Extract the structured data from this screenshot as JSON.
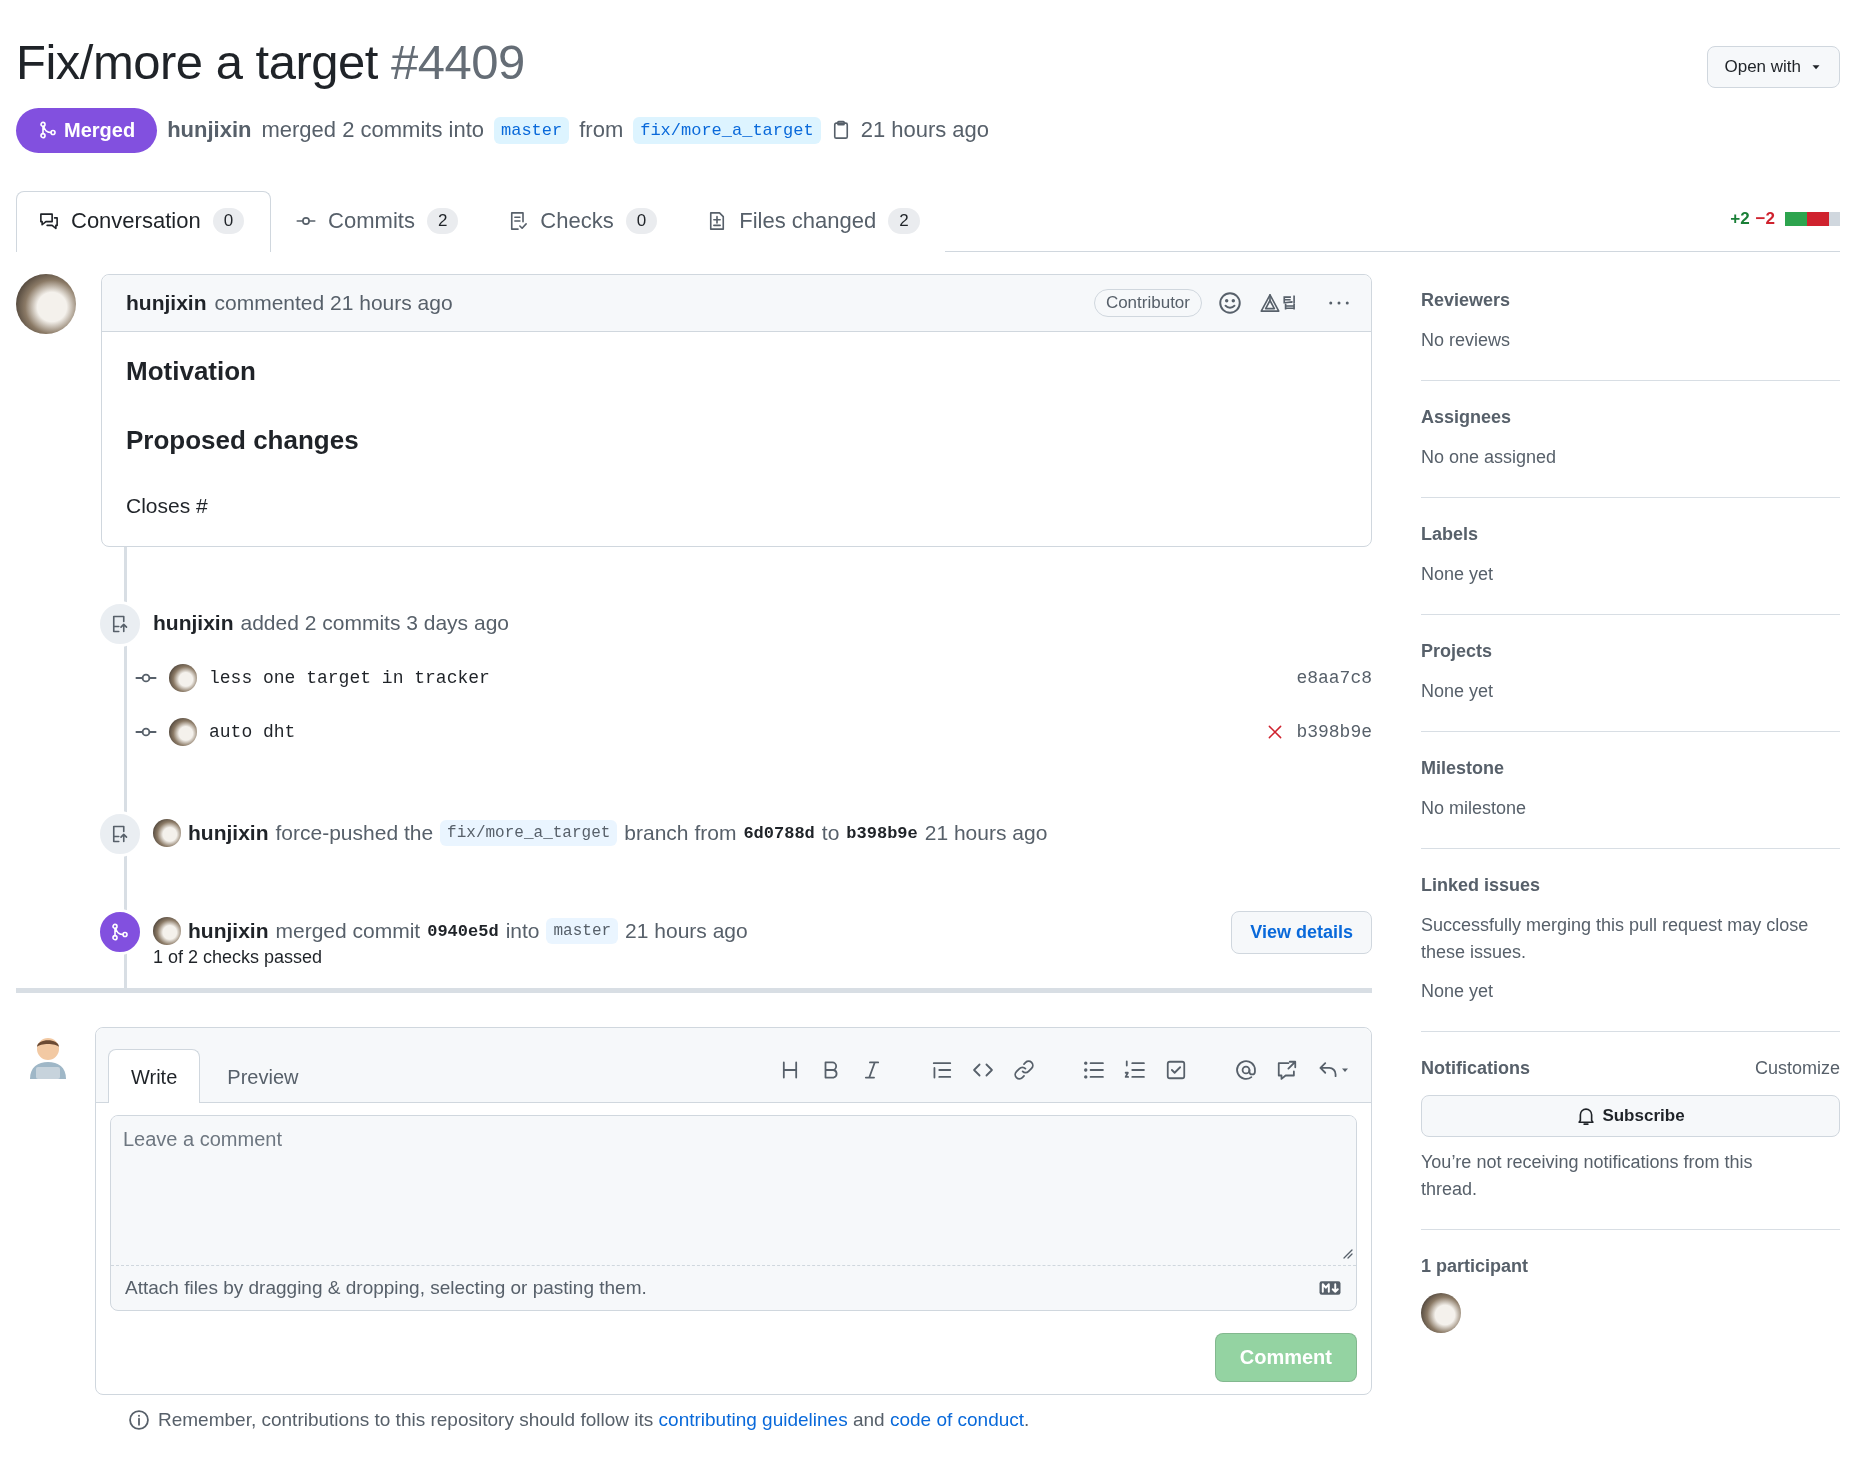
{
  "header": {
    "title": "Fix/more a target",
    "number": "#4409",
    "open_with": "Open with",
    "state": "Merged",
    "author": "hunjixin",
    "summary": "merged 2 commits into",
    "base_branch": "master",
    "from": "from",
    "head_branch": "fix/more_a_target",
    "time": "21 hours ago"
  },
  "tabs": [
    {
      "label": "Conversation",
      "count": "0",
      "kind": "conversation",
      "selected": true
    },
    {
      "label": "Commits",
      "count": "2",
      "kind": "commits",
      "selected": false
    },
    {
      "label": "Checks",
      "count": "0",
      "kind": "checks",
      "selected": false
    },
    {
      "label": "Files changed",
      "count": "2",
      "kind": "files",
      "selected": false
    }
  ],
  "diffstat": {
    "added": "+2",
    "removed": "−2"
  },
  "comment": {
    "author": "hunjixin",
    "action": "commented 21 hours ago",
    "badge": "Contributor",
    "extension": "팁",
    "headings": [
      "Motivation",
      "Proposed changes"
    ],
    "body": "Closes #"
  },
  "timeline": [
    {
      "kind": "commits",
      "author": "hunjixin",
      "parts": [
        {
          "kind": "text",
          "text": "added 2 commits 3 days ago"
        }
      ],
      "commits": [
        {
          "message": "less one target in tracker",
          "sha": "e8aa7c8",
          "failed": false
        },
        {
          "message": "auto dht",
          "sha": "b398b9e",
          "failed": true
        }
      ]
    },
    {
      "kind": "push",
      "author": "hunjixin",
      "parts": [
        {
          "kind": "text",
          "text": "force-pushed the"
        },
        {
          "kind": "branch",
          "text": "fix/more_a_target"
        },
        {
          "kind": "text",
          "text": "branch from"
        },
        {
          "kind": "sha",
          "text": "6d0788d"
        },
        {
          "kind": "text",
          "text": "to"
        },
        {
          "kind": "sha",
          "text": "b398b9e"
        },
        {
          "kind": "text",
          "text": "21 hours ago"
        }
      ]
    },
    {
      "kind": "merge",
      "author": "hunjixin",
      "parts": [
        {
          "kind": "text",
          "text": "merged commit"
        },
        {
          "kind": "sha",
          "text": "0940e5d"
        },
        {
          "kind": "text",
          "text": "into"
        },
        {
          "kind": "branch",
          "text": "master"
        },
        {
          "kind": "text",
          "text": "21 hours ago"
        }
      ],
      "note": "1 of 2 checks passed",
      "button": "View details"
    }
  ],
  "composer": {
    "tabs": [
      {
        "label": "Write",
        "selected": true
      },
      {
        "label": "Preview",
        "selected": false
      }
    ],
    "placeholder": "Leave a comment",
    "attach": "Attach files by dragging & dropping, selecting or pasting them.",
    "submit": "Comment",
    "submit_disabled": true
  },
  "footer": {
    "text": "Remember, contributions to this repository should follow its",
    "link1": "contributing guidelines",
    "middle": "and",
    "link2": "code of conduct",
    "end": "."
  },
  "sidebar": {
    "sections": [
      {
        "title": "Reviewers",
        "lines": [
          "No reviews"
        ]
      },
      {
        "title": "Assignees",
        "lines": [
          "No one assigned"
        ]
      },
      {
        "title": "Labels",
        "lines": [
          "None yet"
        ]
      },
      {
        "title": "Projects",
        "lines": [
          "None yet"
        ]
      },
      {
        "title": "Milestone",
        "lines": [
          "No milestone"
        ]
      },
      {
        "title": "Linked issues",
        "lines": [
          "Successfully merging this pull request may close these issues.",
          "None yet"
        ]
      }
    ],
    "notifications": {
      "title": "Notifications",
      "customize": "Customize",
      "button": "Subscribe",
      "note": "You’re not receiving notifications from this thread."
    },
    "participants": {
      "title": "1 participant"
    }
  }
}
